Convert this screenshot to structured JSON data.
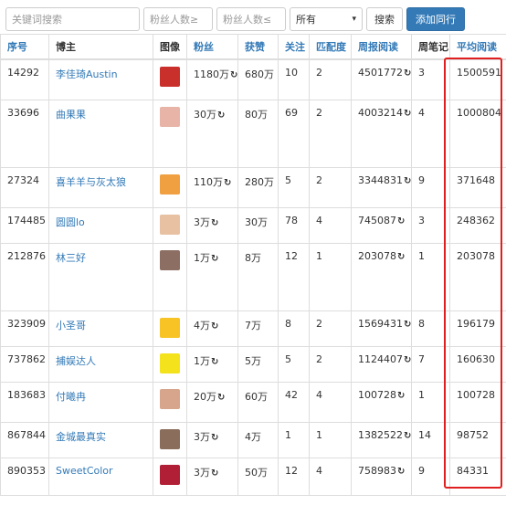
{
  "search": {
    "keyword_placeholder": "关键词搜索",
    "fans_min_placeholder": "粉丝人数≥",
    "fans_max_placeholder": "粉丝人数≤",
    "filter_selected": "所有",
    "search_button": "搜索",
    "add_button": "添加同行"
  },
  "table": {
    "headers": [
      "序号",
      "博主",
      "图像",
      "粉丝",
      "获赞",
      "关注",
      "匹配度",
      "周报阅读",
      "周笔记",
      "平均阅读"
    ],
    "rows": [
      {
        "id": "14292",
        "name": "李佳琦Austin",
        "fans": "1180万",
        "likes": "680万",
        "follow": "10",
        "match": "2",
        "weekly_read": "4501772",
        "notes": "3",
        "avg_read": "1500591"
      },
      {
        "id": "33696",
        "name": "曲果果",
        "fans": "30万",
        "likes": "80万",
        "follow": "69",
        "match": "2",
        "weekly_read": "4003214",
        "notes": "4",
        "avg_read": "1000804"
      },
      {
        "id": "27324",
        "name": "喜羊羊与灰太狼",
        "fans": "110万",
        "likes": "280万",
        "follow": "5",
        "match": "2",
        "weekly_read": "3344831",
        "notes": "9",
        "avg_read": "371648"
      },
      {
        "id": "174485",
        "name": "圆圆lo",
        "fans": "3万",
        "likes": "30万",
        "follow": "78",
        "match": "4",
        "weekly_read": "745087",
        "notes": "3",
        "avg_read": "248362"
      },
      {
        "id": "212876",
        "name": "林三好",
        "fans": "1万",
        "likes": "8万",
        "follow": "12",
        "match": "1",
        "weekly_read": "203078",
        "notes": "1",
        "avg_read": "203078"
      },
      {
        "id": "323909",
        "name": "小圣哥",
        "fans": "4万",
        "likes": "7万",
        "follow": "8",
        "match": "2",
        "weekly_read": "1569431",
        "notes": "8",
        "avg_read": "196179"
      },
      {
        "id": "737862",
        "name": "捕娱达人",
        "fans": "1万",
        "likes": "5万",
        "follow": "5",
        "match": "2",
        "weekly_read": "1124407",
        "notes": "7",
        "avg_read": "160630"
      },
      {
        "id": "183683",
        "name": "付曦冉",
        "fans": "20万",
        "likes": "60万",
        "follow": "42",
        "match": "4",
        "weekly_read": "100728",
        "notes": "1",
        "avg_read": "100728"
      },
      {
        "id": "867844",
        "name": "金城最真实",
        "fans": "3万",
        "likes": "4万",
        "follow": "1",
        "match": "1",
        "weekly_read": "1382522",
        "notes": "14",
        "avg_read": "98752"
      },
      {
        "id": "890353",
        "name": "SweetColor",
        "fans": "3万",
        "likes": "50万",
        "follow": "12",
        "match": "4",
        "weekly_read": "758983",
        "notes": "9",
        "avg_read": "84331"
      }
    ]
  },
  "icons": {
    "refresh": "refresh-icon",
    "select_caret": "chevron-down-icon"
  },
  "colors": {
    "link": "#337ab7",
    "primary": "#337ab7",
    "highlight": "#e02020"
  },
  "refresh_glyph": "↻"
}
